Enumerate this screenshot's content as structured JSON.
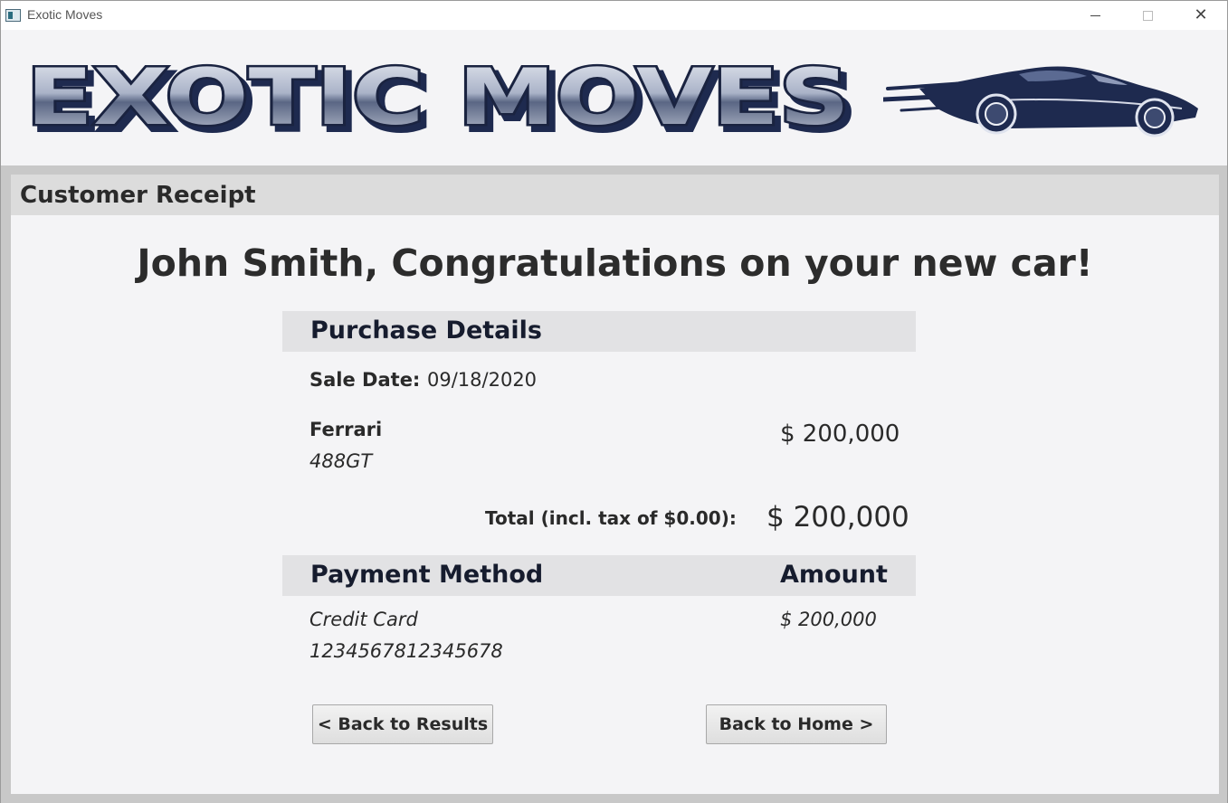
{
  "window": {
    "title": "Exotic Moves",
    "icon": "app-window-icon"
  },
  "banner": {
    "logo_text": "EXOTIC MOVES",
    "logo_color": "#1e2a4f"
  },
  "receipt": {
    "section_title": "Customer Receipt",
    "headline": "John Smith, Congratulations on your new car!",
    "purchase_details_label": "Purchase Details",
    "sale_date_label": "Sale Date:",
    "sale_date_value": "09/18/2020",
    "car_make": "Ferrari",
    "car_model": "488GT",
    "car_price": "$ 200,000",
    "total_label": "Total (incl. tax of $0.00):",
    "total_value": "$ 200,000",
    "payment_method_header": "Payment Method",
    "amount_header": "Amount",
    "payment_type": "Credit Card",
    "card_number": "1234567812345678",
    "payment_amount": "$ 200,000"
  },
  "buttons": {
    "back_results": "< Back to Results",
    "back_home": "Back to Home >"
  }
}
